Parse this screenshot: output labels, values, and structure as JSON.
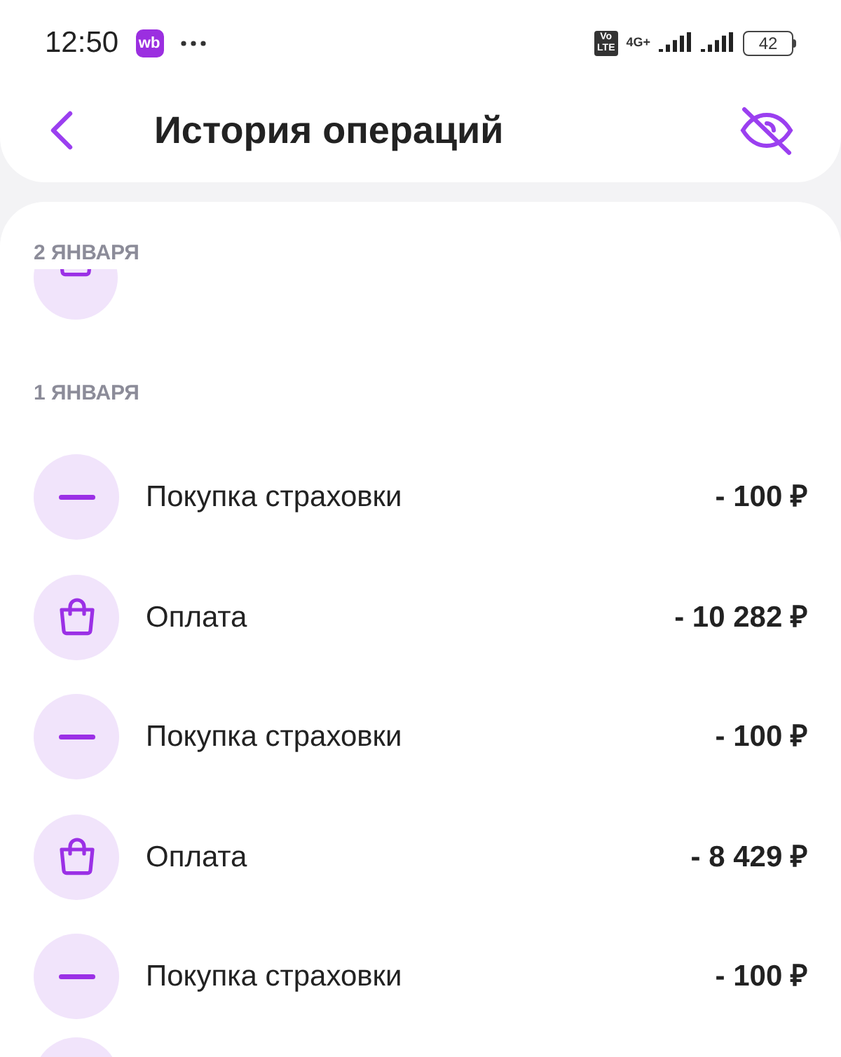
{
  "status_bar": {
    "time": "12:50",
    "app_badge": "wb",
    "volte": [
      "Vo",
      "LTE"
    ],
    "network": "4G+",
    "battery": "42"
  },
  "header": {
    "title": "История операций"
  },
  "groups": [
    {
      "date": "2 ЯНВАРЯ",
      "partial_row": {
        "kind": "payment"
      }
    },
    {
      "date": "1 ЯНВАРЯ",
      "rows": [
        {
          "kind": "insurance",
          "label": "Покупка страховки",
          "amount": "- 100 ₽"
        },
        {
          "kind": "payment",
          "label": "Оплата",
          "amount": "- 10 282 ₽"
        },
        {
          "kind": "insurance",
          "label": "Покупка страховки",
          "amount": "- 100 ₽"
        },
        {
          "kind": "payment",
          "label": "Оплата",
          "amount": "- 8 429 ₽"
        },
        {
          "kind": "insurance",
          "label": "Покупка страховки",
          "amount": "- 100 ₽"
        }
      ]
    }
  ]
}
